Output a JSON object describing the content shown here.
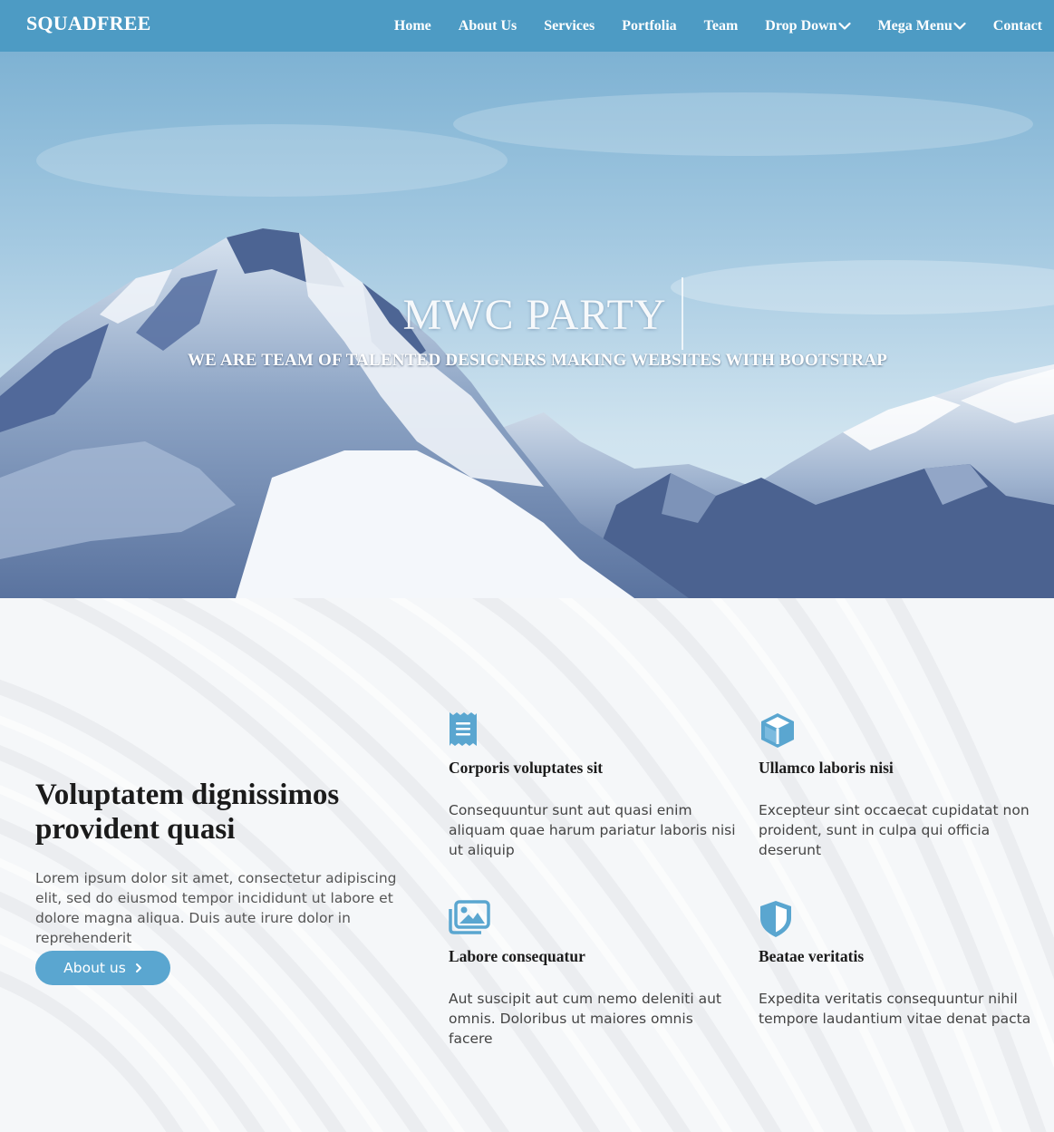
{
  "brand": "SQUADFREE",
  "nav": {
    "items": [
      {
        "label": "Home"
      },
      {
        "label": "About Us"
      },
      {
        "label": "Services"
      },
      {
        "label": "Portfolia"
      },
      {
        "label": "Team"
      },
      {
        "label": "Drop Down",
        "icon": "chevron-down-icon"
      },
      {
        "label": "Mega Menu",
        "icon": "chevron-down-icon"
      },
      {
        "label": "Contact"
      }
    ]
  },
  "hero": {
    "title": "MWC PARTY",
    "subtitle": "WE ARE TEAM OF TALENTED DESIGNERS MAKING WEBSITES WITH BOOTSTRAP"
  },
  "about": {
    "title": "Voluptatem dignissimos provident quasi",
    "text": "Lorem ipsum dolor sit amet, consectetur adipiscing elit, sed do eiusmod tempor incididunt ut labore et dolore magna aliqua. Duis aute irure dolor in reprehenderit",
    "button_label": "About us",
    "button_icon": "chevron-right-icon"
  },
  "features": [
    {
      "icon": "receipt-icon",
      "title": "Corporis voluptates sit",
      "text": "Consequuntur sunt aut quasi enim aliquam quae harum pariatur laboris nisi ut aliquip"
    },
    {
      "icon": "cube-icon",
      "title": "Ullamco laboris nisi",
      "text": "Excepteur sint occaecat cupidatat non proident, sunt in culpa qui officia deserunt"
    },
    {
      "icon": "images-icon",
      "title": "Labore consequatur",
      "text": "Aut suscipit aut cum nemo deleniti aut omnis. Doloribus ut maiores omnis facere"
    },
    {
      "icon": "shield-icon",
      "title": "Beatae veritatis",
      "text": "Expedita veritatis consequuntur nihil tempore laudantium vitae denat pacta"
    }
  ],
  "colors": {
    "primary": "#4d9bc4",
    "accent": "#5aa6d0",
    "heading": "#1b1b1b",
    "body_text": "#555555"
  }
}
